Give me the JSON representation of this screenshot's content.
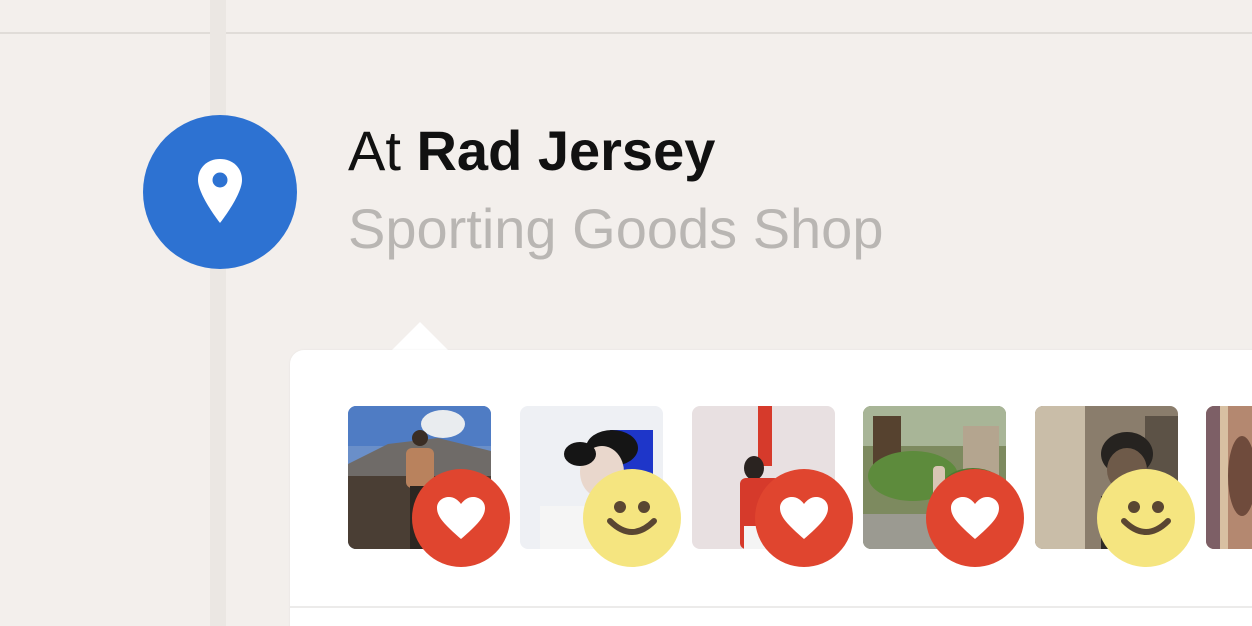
{
  "place": {
    "prefix": "At",
    "name": "Rad Jersey",
    "category": "Sporting Goods Shop",
    "badge_icon": "location-pin-icon",
    "badge_color": "#2d72d2"
  },
  "reactions": [
    {
      "photo": "person-at-volcano-photo",
      "reaction": "love-icon"
    },
    {
      "photo": "woman-portrait-photo",
      "reaction": "smile-icon"
    },
    {
      "photo": "woman-red-sweater-photo",
      "reaction": "love-icon"
    },
    {
      "photo": "garden-street-photo",
      "reaction": "love-icon"
    },
    {
      "photo": "person-indoor-photo",
      "reaction": "smile-icon"
    },
    {
      "photo": "blurred-photo",
      "reaction": ""
    }
  ],
  "colors": {
    "love": "#e0452f",
    "smile": "#f5e580",
    "background": "#f3efec",
    "card": "#ffffff"
  }
}
